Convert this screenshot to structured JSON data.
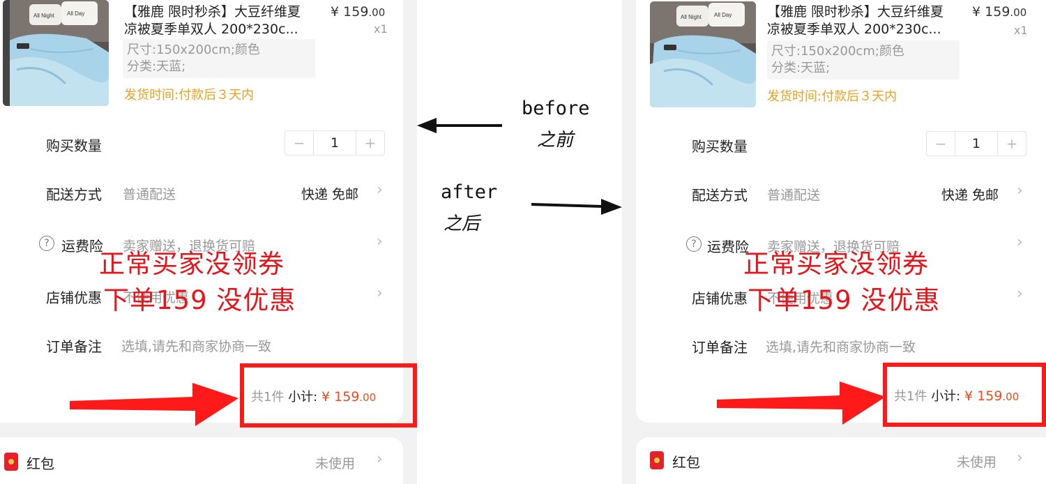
{
  "product": {
    "title_line1": "【雅鹿 限时秒杀】大豆纤维夏",
    "title_line2": "凉被夏季单双人 200*230c...",
    "price_currency": "¥",
    "price_int": "159",
    "price_dec": ".00",
    "qty_badge": "x1",
    "sku_line1": "尺寸:150x200cm;颜色",
    "sku_line2": "分类:天蓝;",
    "ship_time": "发货时间:付款后３天内",
    "pillow_text1": "All Night",
    "pillow_text2": "All Day"
  },
  "rows": {
    "quantity_label": "购买数量",
    "quantity_value": "1",
    "minus": "−",
    "plus": "+",
    "delivery_label": "配送方式",
    "delivery_value": "普通配送",
    "delivery_right": "快递 免邮",
    "insurance_label": "运费险",
    "insurance_value": "卖家赠送，退换货可赔",
    "store_label": "店铺优惠",
    "store_value": "不使用优惠",
    "note_label": "订单备注",
    "note_placeholder": "选填,请先和商家协商一致"
  },
  "subtotal": {
    "count": "共1件",
    "label": "小计:",
    "currency": "¥",
    "amount_int": "159",
    "amount_dec": ".00"
  },
  "hongbao": {
    "label": "红包",
    "value": "未使用"
  },
  "overlay": {
    "line1": "正常买家没领券",
    "line2": "下单159 没优惠"
  },
  "annotations": {
    "before_en": "before",
    "before_cn": "之前",
    "after_en": "after",
    "after_cn": "之后"
  },
  "colors": {
    "accent_red": "#ff1a1a",
    "price_orange": "#f04a1a",
    "ship_yellow": "#f0a020"
  }
}
